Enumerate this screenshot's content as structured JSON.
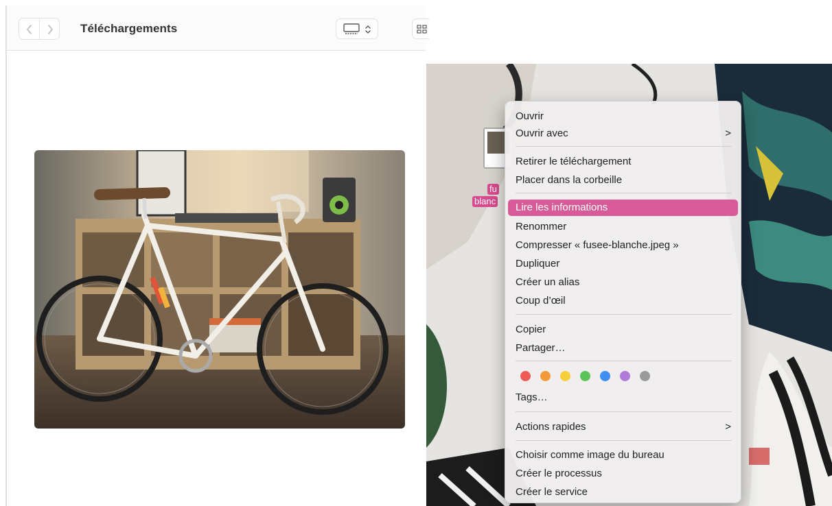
{
  "finder": {
    "title": "Téléchargements",
    "back_icon": "chevron-left-icon",
    "forward_icon": "chevron-right-icon",
    "view_icon": "display-icon",
    "grid_icon": "grid-icon"
  },
  "desktop": {
    "file_label_line1": "fu",
    "file_label_line2": "blanc"
  },
  "context_menu": {
    "items": [
      "Ouvrir",
      "Ouvrir avec",
      "Retirer le téléchargement",
      "Placer dans la corbeille",
      "Lire les informations",
      "Renommer",
      "Compresser « fusee-blanche.jpeg »",
      "Dupliquer",
      "Créer un alias",
      "Coup d’œil",
      "Copier",
      "Partager…",
      "Tags…",
      "Actions rapides",
      "Choisir comme image du bureau",
      "Créer le processus",
      "Créer le service"
    ],
    "highlight_color": "#d65b96",
    "tag_colors": [
      "#ee5a55",
      "#f39b38",
      "#f5cf3d",
      "#5cc35b",
      "#3f8ff2",
      "#b07ad9",
      "#9a9a9a"
    ]
  }
}
